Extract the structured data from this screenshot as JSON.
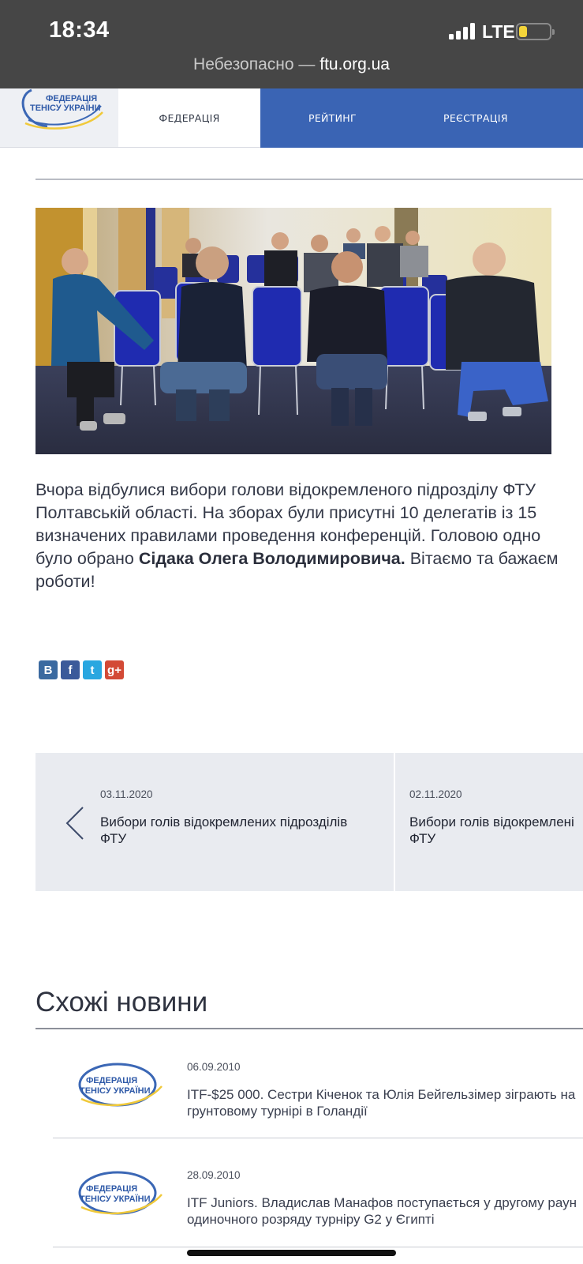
{
  "status_bar": {
    "time": "18:34",
    "network": "LTE",
    "battery_level": 0.25
  },
  "browser": {
    "security_label": "Небезопасно —",
    "domain": "ftu.org.ua"
  },
  "nav": {
    "logo_line1": "ФЕДЕРАЦІЯ",
    "logo_line2": "ТЕНІСУ УКРАЇНИ",
    "items": [
      {
        "label": "ФЕДЕРАЦІЯ"
      },
      {
        "label": "РЕЙТИНГ"
      },
      {
        "label": "РЕЄСТРАЦІЯ"
      }
    ]
  },
  "article": {
    "lines": [
      "Вчора відбулися вибори голови відокремленого підрозділу ФТУ",
      "Полтавській області. На зборах були присутні 10 делегатів із 15",
      "визначених правилами проведення конференцій. Головою одно",
      "було обрано ",
      " Вітаємо та бажаєм",
      "роботи!"
    ],
    "bold_name": "Сідака Олега Володимировича."
  },
  "share": [
    {
      "letter": "В",
      "color": "#3b6aa0"
    },
    {
      "letter": "f",
      "color": "#3b5a9a"
    },
    {
      "letter": "t",
      "color": "#2aa7e0"
    },
    {
      "letter": "g+",
      "color": "#d34a36"
    }
  ],
  "post_nav": {
    "prev": {
      "date": "03.11.2020",
      "title_line1": "Вибори голів відокремлених підрозділів",
      "title_line2": "ФТУ"
    },
    "next": {
      "date": "02.11.2020",
      "title_line1": "Вибори голів відокремлені",
      "title_line2": "ФТУ"
    }
  },
  "related": {
    "heading": "Схожі новини",
    "items": [
      {
        "date": "06.09.2010",
        "title_line1": "ITF-$25 000. Сестри Кіченок та Юлія Бейгельзімер зіграють на",
        "title_line2": "грунтовому турнірі в Голандії"
      },
      {
        "date": "28.09.2010",
        "title_line1": "ITF Juniors. Владислав Манафов поступається у другому раун",
        "title_line2": "одиночного розряду турніру G2 у Єгипті"
      }
    ]
  },
  "colors": {
    "nav_blue": "#3a64b4",
    "chair_blue": "#1f2f9a"
  }
}
